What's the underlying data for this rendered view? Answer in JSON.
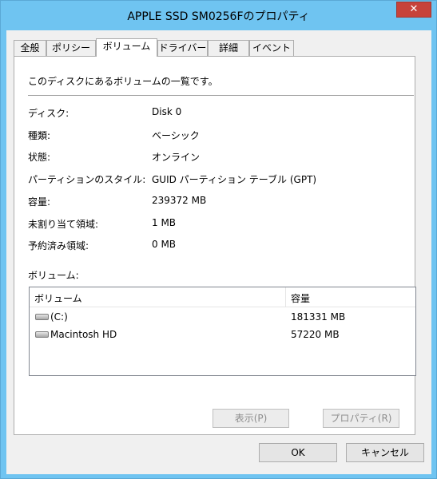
{
  "window": {
    "title": "APPLE SSD SM0256Fのプロパティ",
    "close_glyph": "✕"
  },
  "tabs": [
    "全般",
    "ポリシー",
    "ボリューム",
    "ドライバー",
    "詳細",
    "イベント"
  ],
  "active_tab": "ボリューム",
  "panel": {
    "intro": "このディスクにあるボリュームの一覧です。",
    "props": [
      {
        "label": "ディスク:",
        "value": "Disk 0"
      },
      {
        "label": "種類:",
        "value": "ベーシック"
      },
      {
        "label": "状態:",
        "value": "オンライン"
      },
      {
        "label": "パーティションのスタイル:",
        "value": "GUID パーティション テーブル (GPT)"
      },
      {
        "label": "容量:",
        "value": "239372 MB"
      },
      {
        "label": "未割り当て領域:",
        "value": "1 MB"
      },
      {
        "label": "予約済み領域:",
        "value": "0 MB"
      }
    ],
    "volumes_label": "ボリューム:",
    "columns": {
      "volume": "ボリューム",
      "capacity": "容量"
    },
    "volumes": [
      {
        "name": "(C:)",
        "capacity": "181331 MB",
        "icon": "drive-icon"
      },
      {
        "name": "Macintosh HD",
        "capacity": "57220 MB",
        "icon": "drive-icon"
      }
    ],
    "buttons": {
      "show": "表示(P)",
      "properties": "プロパティ(R)"
    }
  },
  "footer": {
    "ok": "OK",
    "cancel": "キャンセル"
  }
}
